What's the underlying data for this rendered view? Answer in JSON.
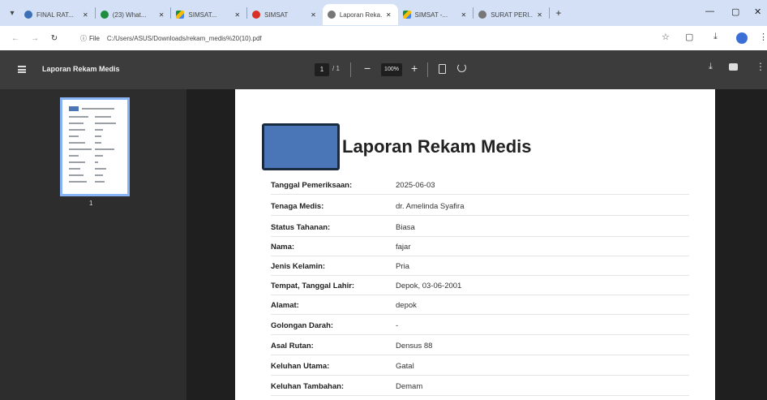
{
  "browser": {
    "tabs": [
      {
        "title": "FINAL RAT...",
        "icon": "globe-icon",
        "active": false
      },
      {
        "title": "(23) What...",
        "icon": "whatsapp-icon",
        "active": false
      },
      {
        "title": "SIMSAT...",
        "icon": "drive-icon",
        "active": false
      },
      {
        "title": "SIMSAT",
        "icon": "globe-icon",
        "active": false
      },
      {
        "title": "Laporan Reka...",
        "icon": "globe-icon",
        "active": true
      },
      {
        "title": "SIMSAT -...",
        "icon": "drive-icon",
        "active": false
      },
      {
        "title": "SURAT PERI...",
        "icon": "globe-icon",
        "active": false
      }
    ],
    "address": {
      "chip_label": "File",
      "url": "C:/Users/ASUS/Downloads/rekam_medis%20(10).pdf"
    }
  },
  "pdf_toolbar": {
    "doc_title": "Laporan Rekam Medis",
    "page_current": "1",
    "page_total": "/ 1",
    "zoom": "100%"
  },
  "sidebar": {
    "thumbnail_label": "1"
  },
  "document": {
    "title": "Laporan Rekam Medis",
    "rows": [
      {
        "label": "Tanggal Pemeriksaan:",
        "value": "2025-06-03"
      },
      {
        "label": "Tenaga Medis:",
        "value": "dr. Amelinda Syafira"
      },
      {
        "label": "Status Tahanan:",
        "value": "Biasa"
      },
      {
        "label": "Nama:",
        "value": "fajar"
      },
      {
        "label": "Jenis Kelamin:",
        "value": "Pria"
      },
      {
        "label": "Tempat, Tanggal Lahir:",
        "value": "Depok, 03-06-2001"
      },
      {
        "label": "Alamat:",
        "value": "depok"
      },
      {
        "label": "Golongan Darah:",
        "value": "-"
      },
      {
        "label": "Asal Rutan:",
        "value": "Densus 88"
      },
      {
        "label": "Keluhan Utama:",
        "value": "Gatal"
      },
      {
        "label": "Keluhan Tambahan:",
        "value": "Demam"
      }
    ]
  }
}
